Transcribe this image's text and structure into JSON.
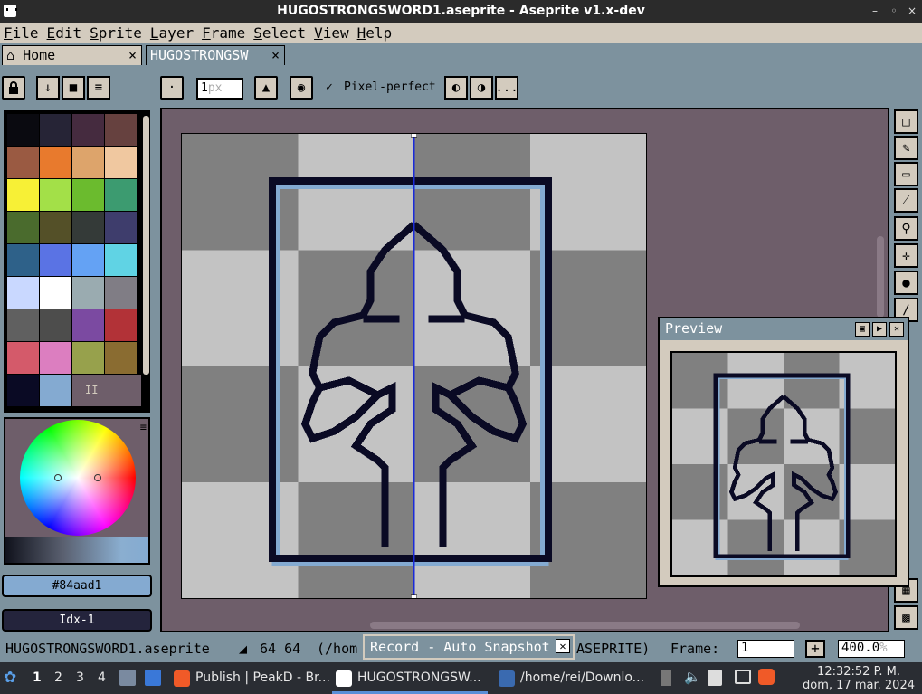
{
  "window": {
    "title": "HUGOSTRONGSWORD1.aseprite - Aseprite v1.x-dev",
    "controls": [
      "–",
      "◦",
      "×"
    ]
  },
  "menu": [
    "File",
    "Edit",
    "Sprite",
    "Layer",
    "Frame",
    "Select",
    "View",
    "Help"
  ],
  "tabs": [
    {
      "label": "Home",
      "close": "×"
    },
    {
      "label": "HUGOSTRONGSW",
      "close": "×"
    }
  ],
  "toolbar": {
    "brush_size": "1",
    "brush_unit": "px",
    "pixel_perfect": "Pixel-perfect",
    "more": "..."
  },
  "palette": {
    "colors": [
      "#0a0a10",
      "#262436",
      "#452b3f",
      "#66413f",
      "#9a5a42",
      "#e87a2d",
      "#dda46b",
      "#f0c8a0",
      "#f7f036",
      "#a3e048",
      "#6bbb2e",
      "#3c9b70",
      "#4a6b2d",
      "#545028",
      "#343a38",
      "#3e3d6c",
      "#2e6189",
      "#5a73e4",
      "#64a2f4",
      "#60d3e4",
      "#c9d8ff",
      "#ffffff",
      "#9aabb0",
      "#807d85",
      "#606060",
      "#4d4d4c",
      "#7b4aa1",
      "#b23237",
      "#d45a6a",
      "#dc7ec0",
      "#97a14c",
      "#8a6c31"
    ],
    "last_row": [
      "#0a0a24",
      "#84aad1"
    ],
    "last_cell_label": "II"
  },
  "color_panel": {
    "hex": "#84aad1",
    "index": "Idx-1",
    "menu": "≡"
  },
  "canvas": {
    "checker_light": "#c3c3c3",
    "checker_dark": "#808080",
    "line_color": "#0a0a24",
    "frame_color": "#84aad1"
  },
  "preview": {
    "title": "Preview"
  },
  "status": {
    "filename": "HUGOSTRONGSWORD1.aseprite",
    "size": "64 64",
    "path_fragment": "(/hom",
    "path_tail": "ASEPRITE)",
    "record": "Record - Auto Snapshot",
    "frame_label": "Frame:",
    "frame_value": "1",
    "plus": "+",
    "zoom": "400.0",
    "zoom_unit": "%"
  },
  "taskbar": {
    "workspaces": [
      "1",
      "2",
      "3",
      "4"
    ],
    "tasks": [
      {
        "label": "Publish | PeakD - Br..."
      },
      {
        "label": "HUGOSTRONGSW..."
      },
      {
        "label": "/home/rei/Downlo..."
      }
    ],
    "clock_time": "12:32:52 P. M.",
    "clock_date": "dom, 17 mar. 2024"
  }
}
